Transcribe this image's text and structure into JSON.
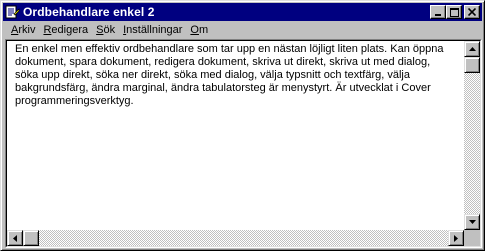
{
  "window": {
    "title": "Ordbehandlare enkel 2",
    "icon": "document-app-icon",
    "controls": {
      "minimize_icon": "minimize-icon",
      "maximize_icon": "maximize-icon",
      "close_icon": "close-icon"
    }
  },
  "menubar": {
    "items": [
      {
        "underline": "A",
        "rest": "rkiv"
      },
      {
        "underline": "R",
        "rest": "edigera"
      },
      {
        "underline": "S",
        "rest": "ök"
      },
      {
        "underline": "I",
        "rest": "nställningar"
      },
      {
        "underline": "O",
        "rest": "m"
      }
    ]
  },
  "editor": {
    "text": "En enkel men effektiv ordbehandlare som tar upp en nästan löjligt liten plats. Kan öppna\ndokument, spara dokument, redigera dokument, skriva ut direkt, skriva ut med dialog,\nsöka upp direkt, söka ner direkt, söka med dialog, välja typsnitt och textfärg, välja\nbakgrundsfärg, ändra marginal, ändra tabulatorsteg är menystyrt. Är utvecklat i Cover\nprogrammeringsverktyg."
  },
  "scrollbars": {
    "vertical": {
      "up_icon": "arrow-up-icon",
      "down_icon": "arrow-down-icon",
      "position": 0
    },
    "horizontal": {
      "left_icon": "arrow-left-icon",
      "right_icon": "arrow-right-icon",
      "position": 0
    }
  },
  "colors": {
    "titlebar": "#000080",
    "face": "#c0c0c0",
    "editor_bg": "#ffffff"
  }
}
